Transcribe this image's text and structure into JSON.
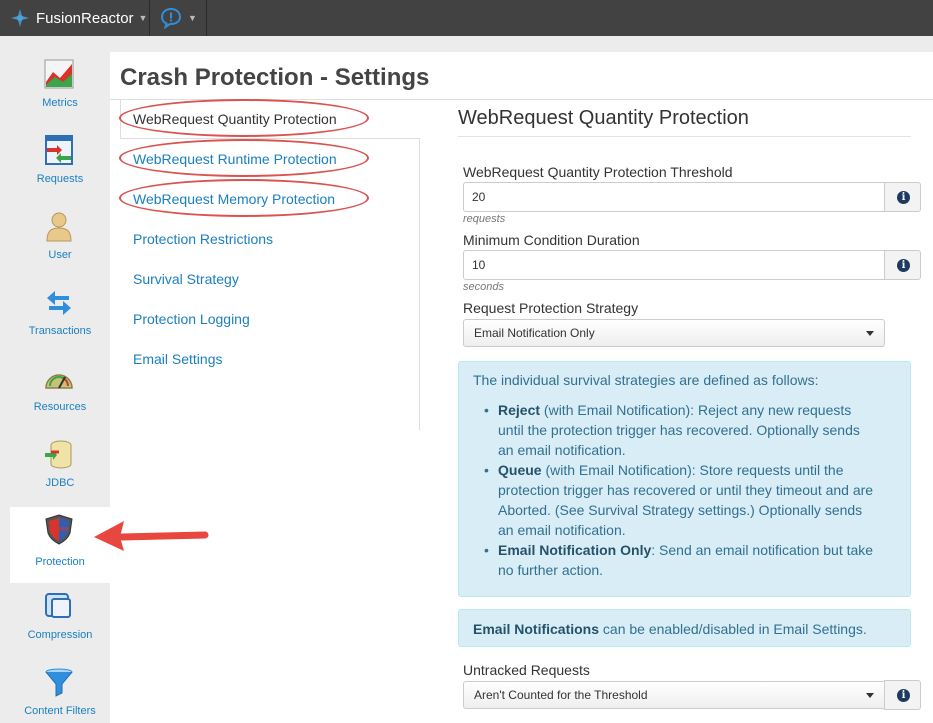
{
  "topbar": {
    "app_name": "FusionReactor"
  },
  "nav": {
    "items": [
      {
        "label": "Metrics",
        "icon": "metrics-chart-icon"
      },
      {
        "label": "Requests",
        "icon": "requests-icon"
      },
      {
        "label": "User",
        "icon": "user-icon"
      },
      {
        "label": "Transactions",
        "icon": "transactions-icon"
      },
      {
        "label": "Resources",
        "icon": "gauge-icon"
      },
      {
        "label": "JDBC",
        "icon": "database-icon"
      },
      {
        "label": "Protection",
        "icon": "shield-icon"
      },
      {
        "label": "Compression",
        "icon": "compression-icon"
      },
      {
        "label": "Content Filters",
        "icon": "funnel-icon"
      }
    ],
    "active": "Protection"
  },
  "page": {
    "title": "Crash Protection - Settings"
  },
  "submenu": [
    "WebRequest Quantity Protection",
    "WebRequest Runtime Protection",
    "WebRequest Memory Protection",
    "Protection Restrictions",
    "Survival Strategy",
    "Protection Logging",
    "Email Settings"
  ],
  "section": {
    "title": "WebRequest Quantity Protection",
    "threshold_label": "WebRequest Quantity Protection Threshold",
    "threshold_value": "20",
    "threshold_help": "requests",
    "duration_label": "Minimum Condition Duration",
    "duration_value": "10",
    "duration_help": "seconds",
    "strategy_label": "Request Protection Strategy",
    "strategy_value": "Email Notification Only",
    "info_intro": "The individual survival strategies are defined as follows:",
    "reject_b": "Reject",
    "reject_t": " (with Email Notification): Reject any new requests until the protection trigger has recovered. Optionally sends an email notification.",
    "queue_b": "Queue",
    "queue_t": " (with Email Notification): Store requests until the protection trigger has recovered or until they timeout and are Aborted. (See Survival Strategy settings.) Optionally sends an email notification.",
    "email_b": "Email Notification Only",
    "email_t": ": Send an email notification but take no further action.",
    "notif_b": "Email Notifications",
    "notif_t": " can be enabled/disabled in Email Settings.",
    "untracked_label": "Untracked Requests",
    "untracked_value": "Aren't Counted for the Threshold"
  },
  "colors": {
    "link": "#1a7fc1",
    "highlight": "#d9534f",
    "topbar": "#424242",
    "info_bg": "#d9edf7"
  }
}
